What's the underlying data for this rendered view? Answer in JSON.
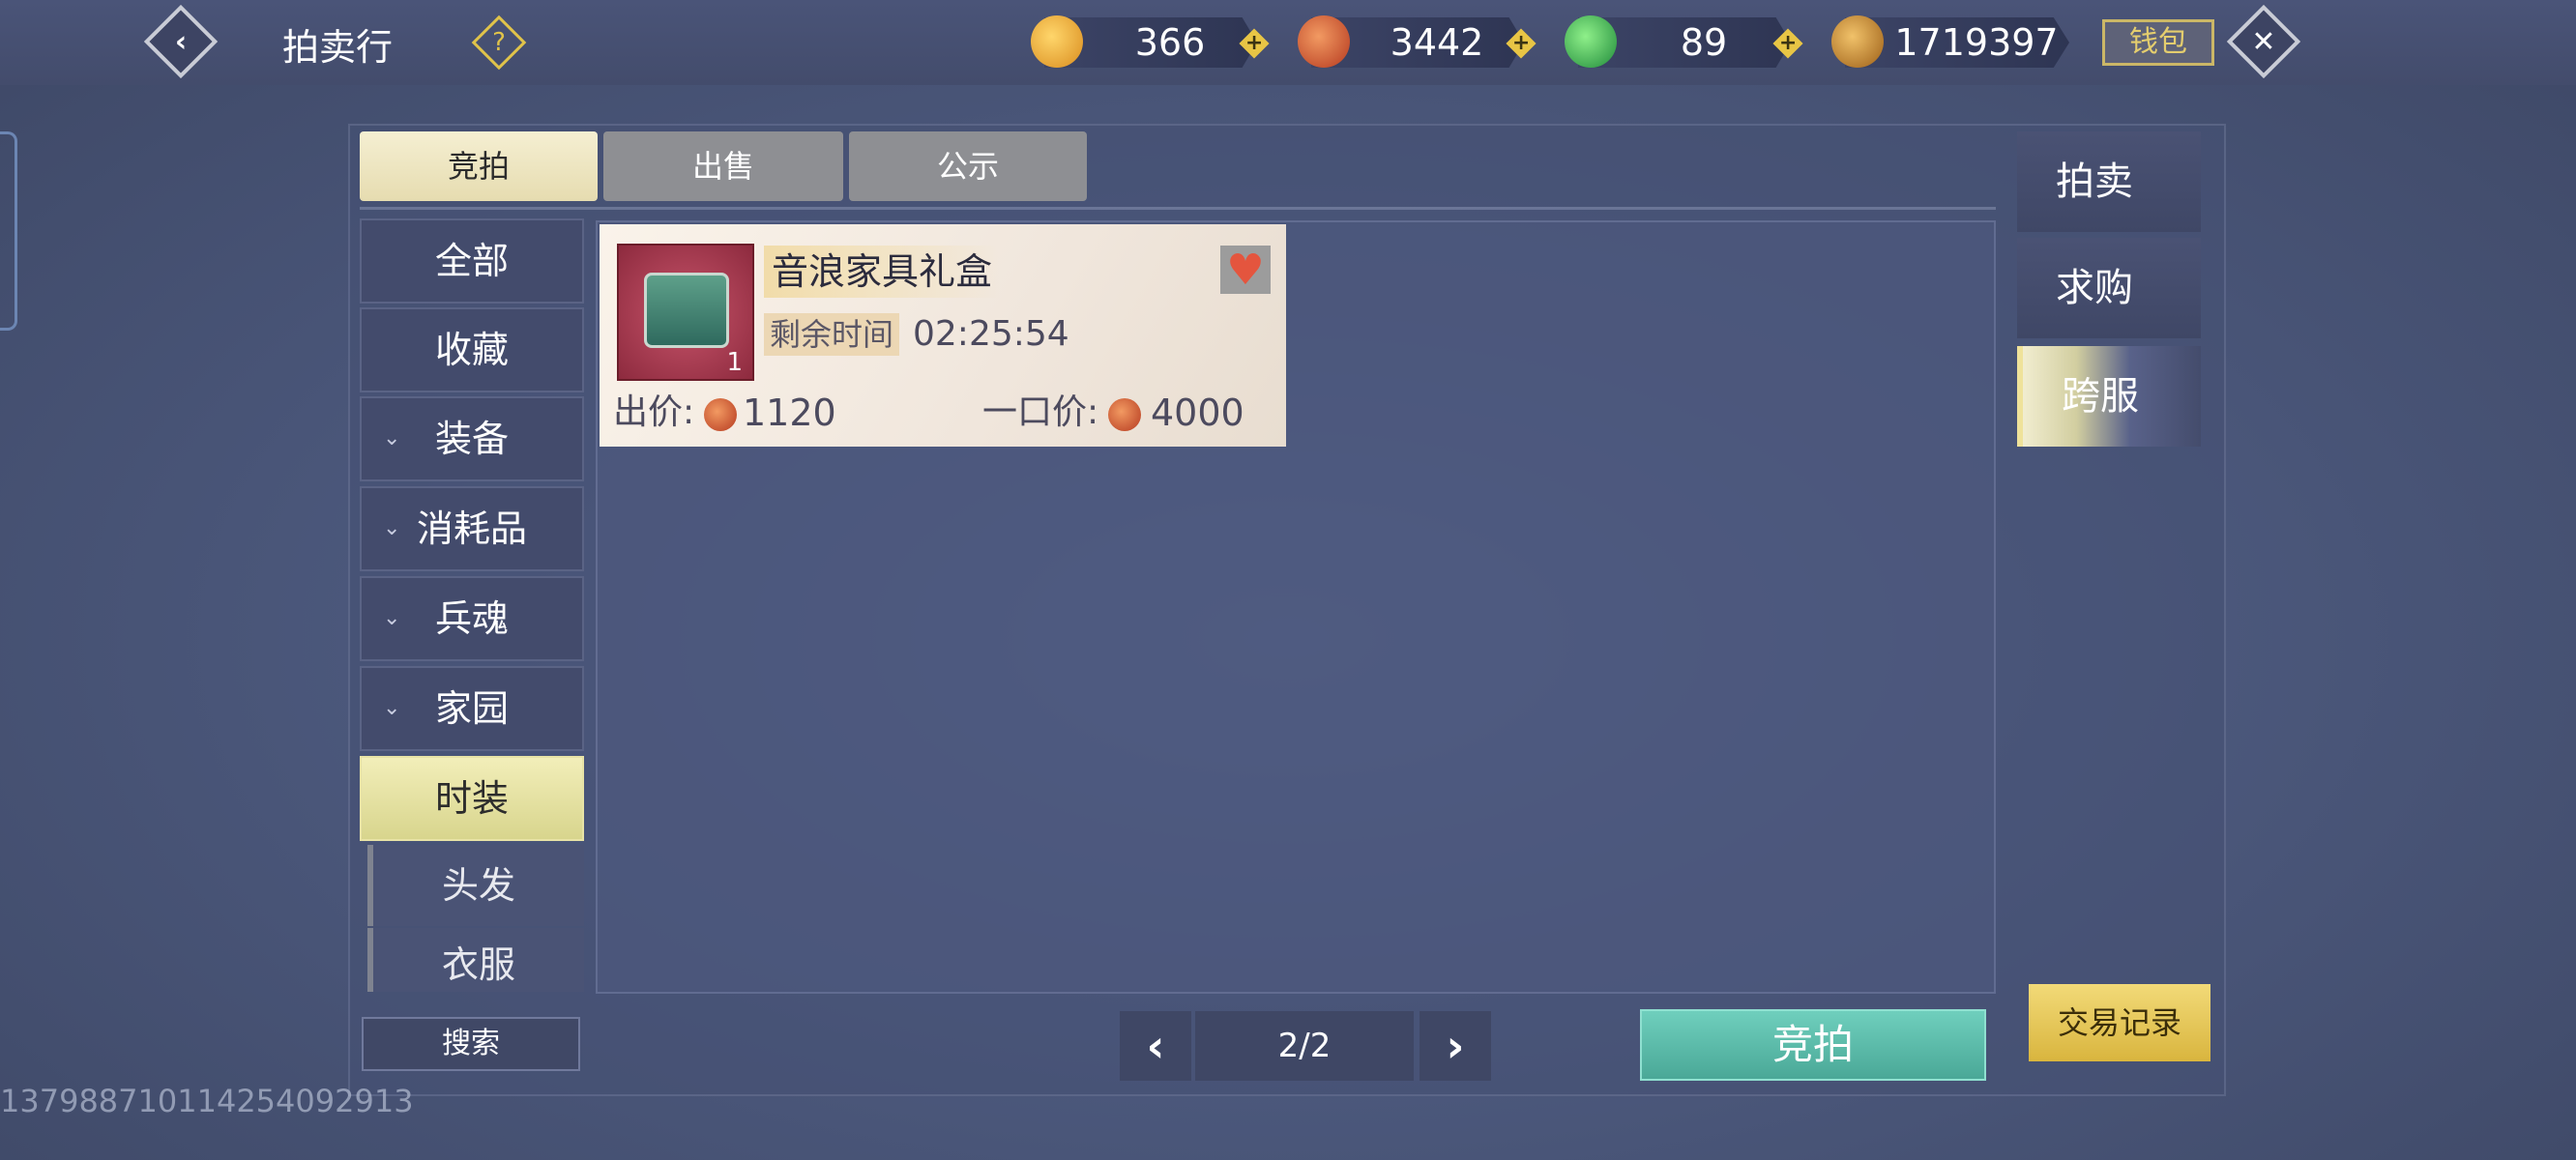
{
  "header": {
    "title": "拍卖行",
    "help_icon": "question-icon",
    "back_icon": "back-arrow-icon",
    "close_icon": "close-x-icon",
    "wallet_label": "钱包"
  },
  "currencies": [
    {
      "name": "gold-coin-icon",
      "value": "366",
      "color": "#e3a02b"
    },
    {
      "name": "red-coin-icon",
      "value": "3442",
      "color": "#c9492b"
    },
    {
      "name": "jade-coin-icon",
      "value": "89",
      "color": "#2fb04a"
    },
    {
      "name": "token-coin-icon",
      "value": "1719397",
      "color": "#c98a2a"
    }
  ],
  "tabs": [
    "竞拍",
    "出售",
    "公示"
  ],
  "categories": [
    {
      "label": "全部",
      "expandable": false
    },
    {
      "label": "收藏",
      "expandable": false
    },
    {
      "label": "装备",
      "expandable": true
    },
    {
      "label": "消耗品",
      "expandable": true
    },
    {
      "label": "兵魂",
      "expandable": true
    },
    {
      "label": "家园",
      "expandable": true
    },
    {
      "label": "时装",
      "expandable": false,
      "active": true
    }
  ],
  "subcategories": [
    "头发",
    "衣服"
  ],
  "item": {
    "name": "音浪家具礼盒",
    "count": "1",
    "time_label": "剩余时间",
    "time_value": "02:25:54",
    "bid_label": "出价:",
    "bid_value": "1120",
    "buyout_label": "一口价:",
    "buyout_value": "4000"
  },
  "side_buttons": [
    "拍卖",
    "求购",
    "跨服"
  ],
  "footer": {
    "search_label": "搜索",
    "page": "2/2",
    "bid_button": "竞拍",
    "record_button": "交易记录"
  },
  "uid": "1379887101142540929​13"
}
